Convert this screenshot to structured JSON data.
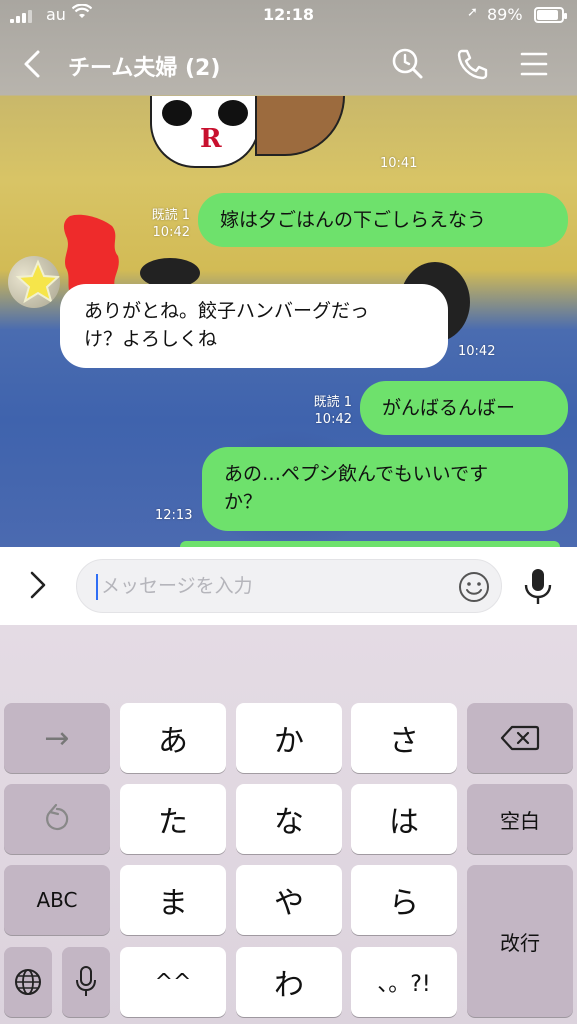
{
  "status_bar": {
    "carrier": "au",
    "time": "12:18",
    "battery_percent": "89%",
    "battery_level": 0.89
  },
  "header": {
    "title": "チーム夫婦 (2)",
    "icons": [
      "chevron-left-icon",
      "search-icon",
      "phone-icon",
      "menu-icon"
    ]
  },
  "messages": [
    {
      "from": "them",
      "kind": "sticker",
      "time": "10:41"
    },
    {
      "from": "me",
      "text": "嫁は夕ごはんの下ごしらえなう",
      "read": "既読 1",
      "time": "10:42"
    },
    {
      "from": "them",
      "lines": [
        "ありがとね。餃子ハンバーグだっ",
        "け？よろしくね"
      ],
      "time": "10:42"
    },
    {
      "from": "me",
      "text": "がんばるんばー",
      "read": "既読 1",
      "time": "10:42"
    },
    {
      "from": "me",
      "lines": [
        "あの…ペプシ飲んでもいいです",
        "か？"
      ],
      "time": "12:13"
    }
  ],
  "composer": {
    "placeholder": "メッセージを入力",
    "value": ""
  },
  "keyboard": {
    "row1": [
      "→",
      "あ",
      "か",
      "さ",
      "⌫"
    ],
    "row2": [
      "↺",
      "た",
      "な",
      "は",
      "空白"
    ],
    "row3": [
      "ABC",
      "ま",
      "や",
      "ら",
      "改行"
    ],
    "row4": [
      "🌐",
      "🎤",
      "^^",
      "わ",
      "、。?!"
    ],
    "colors": {
      "dark_key": "#c3b6c4",
      "light_key": "#ffffff",
      "bubble_me": "#6ee16c"
    }
  }
}
